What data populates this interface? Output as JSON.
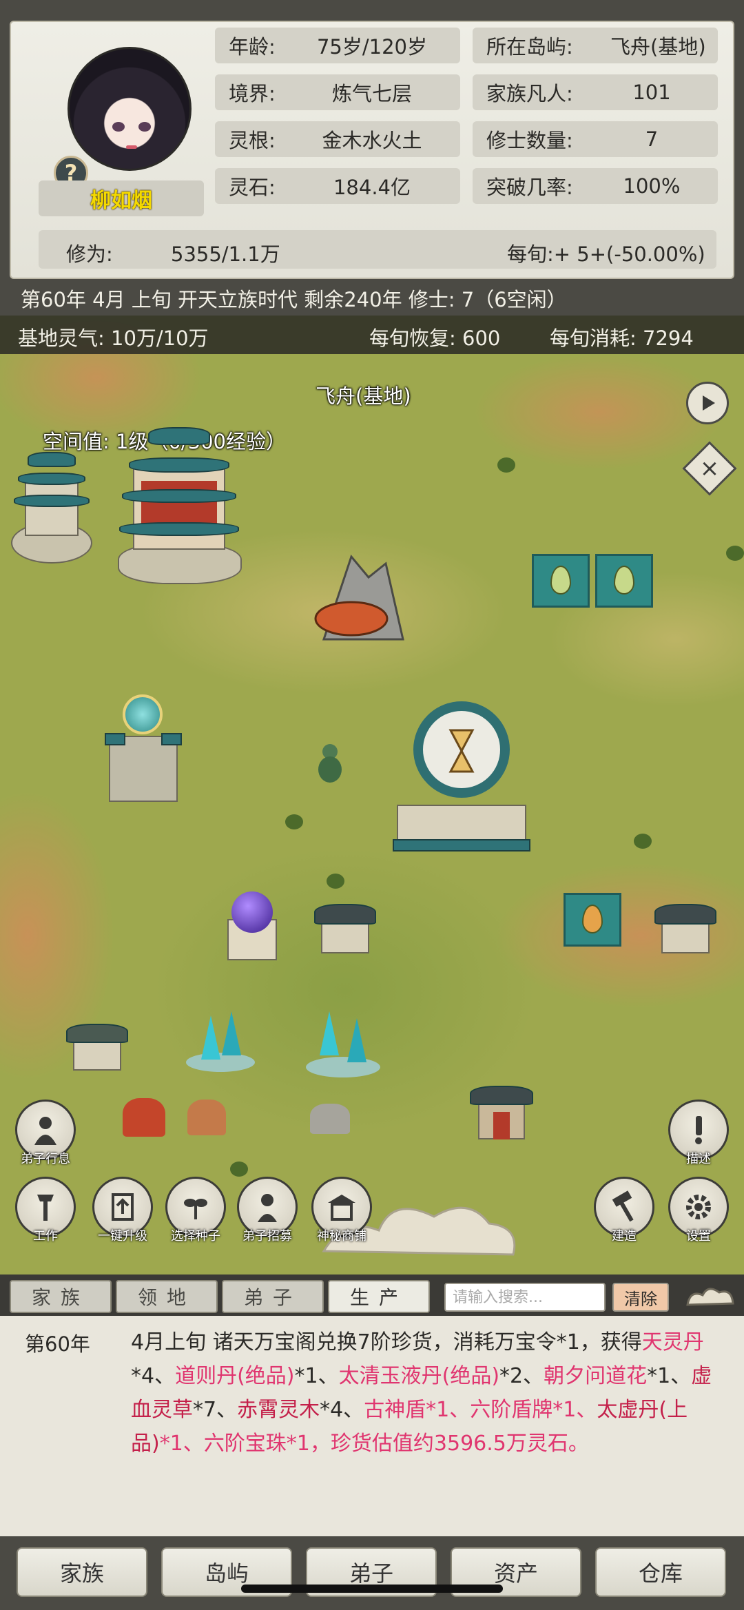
{
  "profile": {
    "name": "柳如烟",
    "help_icon": "?",
    "stats_left": [
      {
        "label": "年龄:",
        "value": "75岁/120岁"
      },
      {
        "label": "境界:",
        "value": "炼气七层"
      },
      {
        "label": "灵根:",
        "value": "金木水火土"
      },
      {
        "label": "灵石:",
        "value": "184.4亿"
      }
    ],
    "stats_right": [
      {
        "label": "所在岛屿:",
        "value": "飞舟(基地)"
      },
      {
        "label": "家族凡人:",
        "value": "101"
      },
      {
        "label": "修士数量:",
        "value": "7"
      },
      {
        "label": "突破几率:",
        "value": "100%"
      }
    ],
    "cultivation_label": "修为:",
    "cultivation_value": "5355/1.1万",
    "per_period_label": "每旬:+ 5+(-50.00%)"
  },
  "status_line": "第60年 4月 上旬  开天立族时代 剩余240年  修士: 7（6空闲）",
  "map": {
    "resource": {
      "aura": "基地灵气: 10万/10万",
      "recovery": "每旬恢复: 600",
      "consume": "每旬消耗: 7294"
    },
    "location_label": "飞舟(基地)",
    "space_label": "空间值: 1级（0/300经验）",
    "play_icon": "play-icon",
    "close_icon": "×",
    "tools_left": [
      {
        "label": "弟子行息",
        "icon": "disciple-icon"
      }
    ],
    "tools_bottom": [
      {
        "label": "工作",
        "icon": "hoe-icon"
      },
      {
        "label": "一键升级",
        "icon": "upgrade-icon"
      },
      {
        "label": "选择种子",
        "icon": "seed-icon"
      },
      {
        "label": "弟子招募",
        "icon": "recruit-icon"
      },
      {
        "label": "神秘商铺",
        "icon": "shop-icon"
      }
    ],
    "tools_right": [
      {
        "label": "描述",
        "icon": "exclaim-icon"
      },
      {
        "label": "建造",
        "icon": "hammer-icon"
      },
      {
        "label": "设置",
        "icon": "gear-icon"
      }
    ]
  },
  "log": {
    "tabs": [
      "家族",
      "领地",
      "弟子",
      "生产"
    ],
    "active_tab": 3,
    "search_placeholder": "请输入搜索...",
    "clear_label": "清除",
    "year": "第60年",
    "segments": [
      {
        "t": "4月上旬 诸天万宝阁兑换7阶珍货，消耗万宝令*1，获得",
        "c": ""
      },
      {
        "t": "天灵丹",
        "c": "pink"
      },
      {
        "t": "*4、",
        "c": ""
      },
      {
        "t": "道则丹(绝品)",
        "c": "pink"
      },
      {
        "t": "*1、",
        "c": ""
      },
      {
        "t": "太清玉液丹(绝品)",
        "c": "pink"
      },
      {
        "t": "*2、",
        "c": ""
      },
      {
        "t": "朝夕问道花",
        "c": "pink"
      },
      {
        "t": "*1、",
        "c": ""
      },
      {
        "t": "虚血灵草",
        "c": "red"
      },
      {
        "t": "*7、",
        "c": ""
      },
      {
        "t": "赤霄灵木",
        "c": "red"
      },
      {
        "t": "*4、",
        "c": ""
      },
      {
        "t": "古神盾*1、六阶盾牌*1、",
        "c": "pink"
      },
      {
        "t": "太虚丹(上品)",
        "c": "red"
      },
      {
        "t": "*1、",
        "c": "pink"
      },
      {
        "t": "六阶宝珠*1，珍货估值约3596.5万灵石。",
        "c": "pink"
      }
    ]
  },
  "bottom_nav": [
    "家族",
    "岛屿",
    "弟子",
    "资产",
    "仓库"
  ],
  "colors": {
    "accent_pink": "#e0356f",
    "accent_red": "#c4204a",
    "name_gold": "#f4d900",
    "map_green": "#9ea84e"
  }
}
